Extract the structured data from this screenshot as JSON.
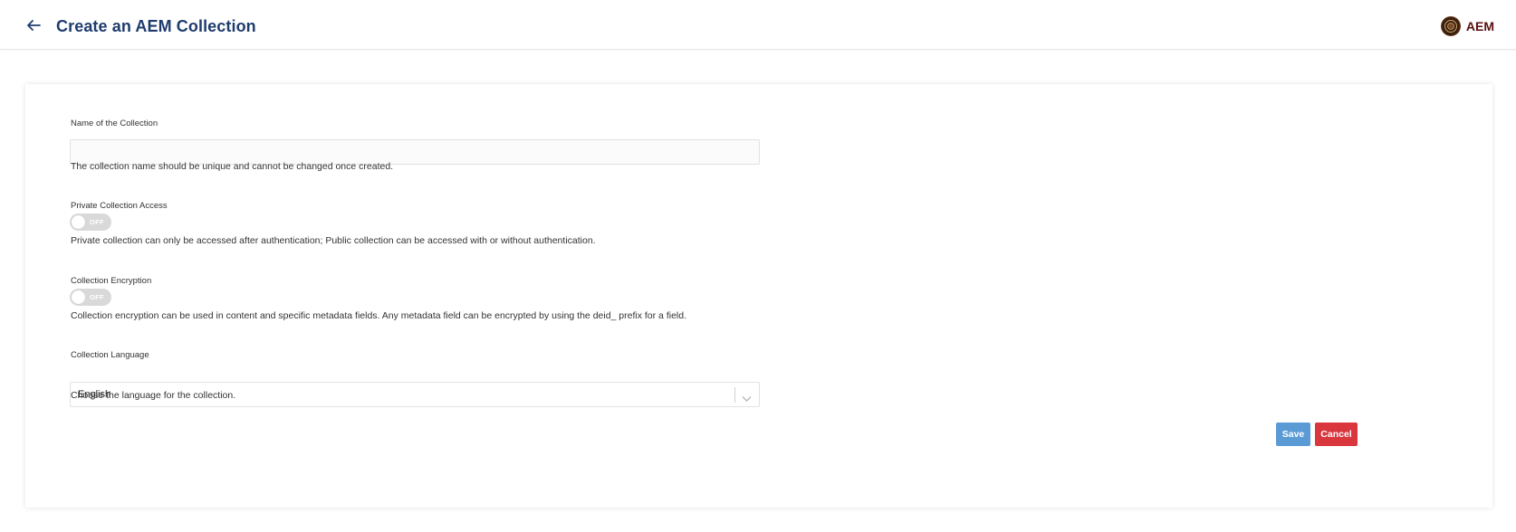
{
  "header": {
    "title": "Create an AEM Collection",
    "brand_text": "AEM",
    "back_icon": "arrow-left-icon",
    "brand_logo_icon": "seal-logo"
  },
  "form": {
    "name": {
      "label": "Name of the Collection",
      "value": "",
      "placeholder": "",
      "help": "The collection name should be unique and cannot be changed once created."
    },
    "private_access": {
      "label": "Private Collection Access",
      "state": "OFF",
      "help": "Private collection can only be accessed after authentication; Public collection can be accessed with or without authentication."
    },
    "encryption": {
      "label": "Collection Encryption",
      "state": "OFF",
      "help": "Collection encryption can be used in content and specific metadata fields. Any metadata field can be encrypted by using the deid_ prefix for a field."
    },
    "language": {
      "label": "Collection Language",
      "value": "English",
      "help": "Choose the language for the collection.",
      "chevron_icon": "chevron-down-icon"
    }
  },
  "actions": {
    "save_label": "Save",
    "cancel_label": "Cancel"
  },
  "colors": {
    "title": "#1f3c6e",
    "brand": "#5a0f0f",
    "save": "#5b9bd5",
    "cancel": "#d9363e",
    "toggle_off": "#d9d9d9"
  }
}
